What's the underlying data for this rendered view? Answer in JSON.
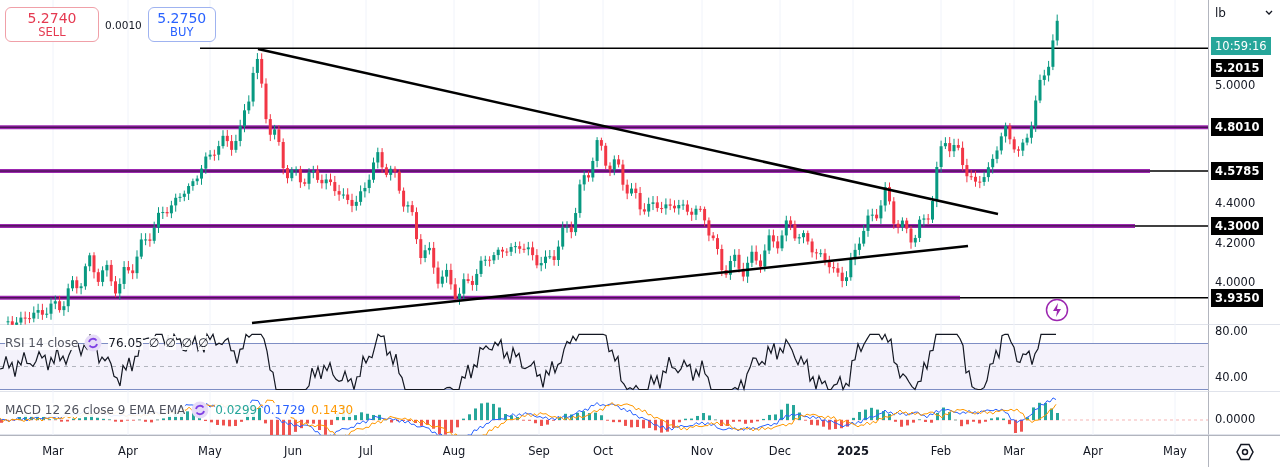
{
  "quote": {
    "sell": {
      "price": "5.2740",
      "label": "SELL"
    },
    "spread": "0.0010",
    "buy": {
      "price": "5.2750",
      "label": "BUY"
    }
  },
  "price_axis": {
    "unit": "lb",
    "countdown": "10:59:16",
    "ticks": [
      "5.0000",
      "4.4000",
      "4.2000",
      "4.0000"
    ]
  },
  "levels": [
    {
      "label": "5.2015",
      "kind": "plain"
    },
    {
      "label": "4.8010",
      "kind": "zone"
    },
    {
      "label": "4.5785",
      "kind": "zone"
    },
    {
      "label": "4.3000",
      "kind": "zone"
    },
    {
      "label": "3.9350",
      "kind": "zone"
    }
  ],
  "rsi": {
    "label": "RSI 14 close",
    "value": "76.05",
    "extras": [
      "∅",
      "∅",
      "∅",
      "∅"
    ],
    "ticks": [
      "80.00",
      "40.00"
    ]
  },
  "macd": {
    "label": "MACD 12 26 close 9 EMA EMA",
    "values": [
      {
        "text": "0.0299",
        "color": "#26a69a"
      },
      {
        "text": "0.1729",
        "color": "#2962ff"
      },
      {
        "text": "0.1430",
        "color": "#ff9800"
      }
    ],
    "ticks": [
      "0.0000"
    ]
  },
  "time_axis": [
    {
      "label": "Mar",
      "kind": "month"
    },
    {
      "label": "Apr",
      "kind": "month"
    },
    {
      "label": "May",
      "kind": "month"
    },
    {
      "label": "Jun",
      "kind": "month"
    },
    {
      "label": "Jul",
      "kind": "month"
    },
    {
      "label": "Aug",
      "kind": "month"
    },
    {
      "label": "Sep",
      "kind": "month"
    },
    {
      "label": "Oct",
      "kind": "month"
    },
    {
      "label": "Nov",
      "kind": "month"
    },
    {
      "label": "Dec",
      "kind": "month"
    },
    {
      "label": "2025",
      "kind": "year"
    },
    {
      "label": "Feb",
      "kind": "month"
    },
    {
      "label": "Mar",
      "kind": "month"
    },
    {
      "label": "Apr",
      "kind": "month"
    },
    {
      "label": "May",
      "kind": "month"
    }
  ]
}
